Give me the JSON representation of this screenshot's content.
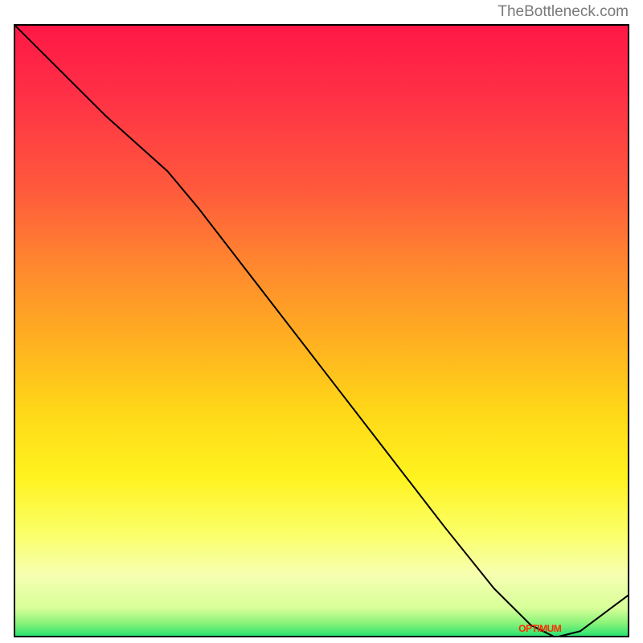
{
  "watermark": "TheBottleneck.com",
  "annotation_label": "OPTIMUM",
  "chart_data": {
    "type": "line",
    "title": "",
    "xlabel": "",
    "ylabel": "",
    "x": [
      0.0,
      0.07,
      0.15,
      0.25,
      0.3,
      0.4,
      0.5,
      0.6,
      0.7,
      0.78,
      0.84,
      0.88,
      0.92,
      1.0
    ],
    "y": [
      1.0,
      0.93,
      0.85,
      0.76,
      0.7,
      0.57,
      0.44,
      0.31,
      0.18,
      0.08,
      0.02,
      0.0,
      0.01,
      0.07
    ],
    "ylim": [
      0,
      1
    ],
    "xlim": [
      0,
      1
    ],
    "optimum_x": 0.875,
    "annotations": [
      {
        "text": "OPTIMUM",
        "x": 0.82,
        "y": 0.005
      }
    ],
    "gradient": {
      "top_color": "#ff1846",
      "mid_color": "#fff31f",
      "bottom_color": "#2ae270"
    }
  }
}
